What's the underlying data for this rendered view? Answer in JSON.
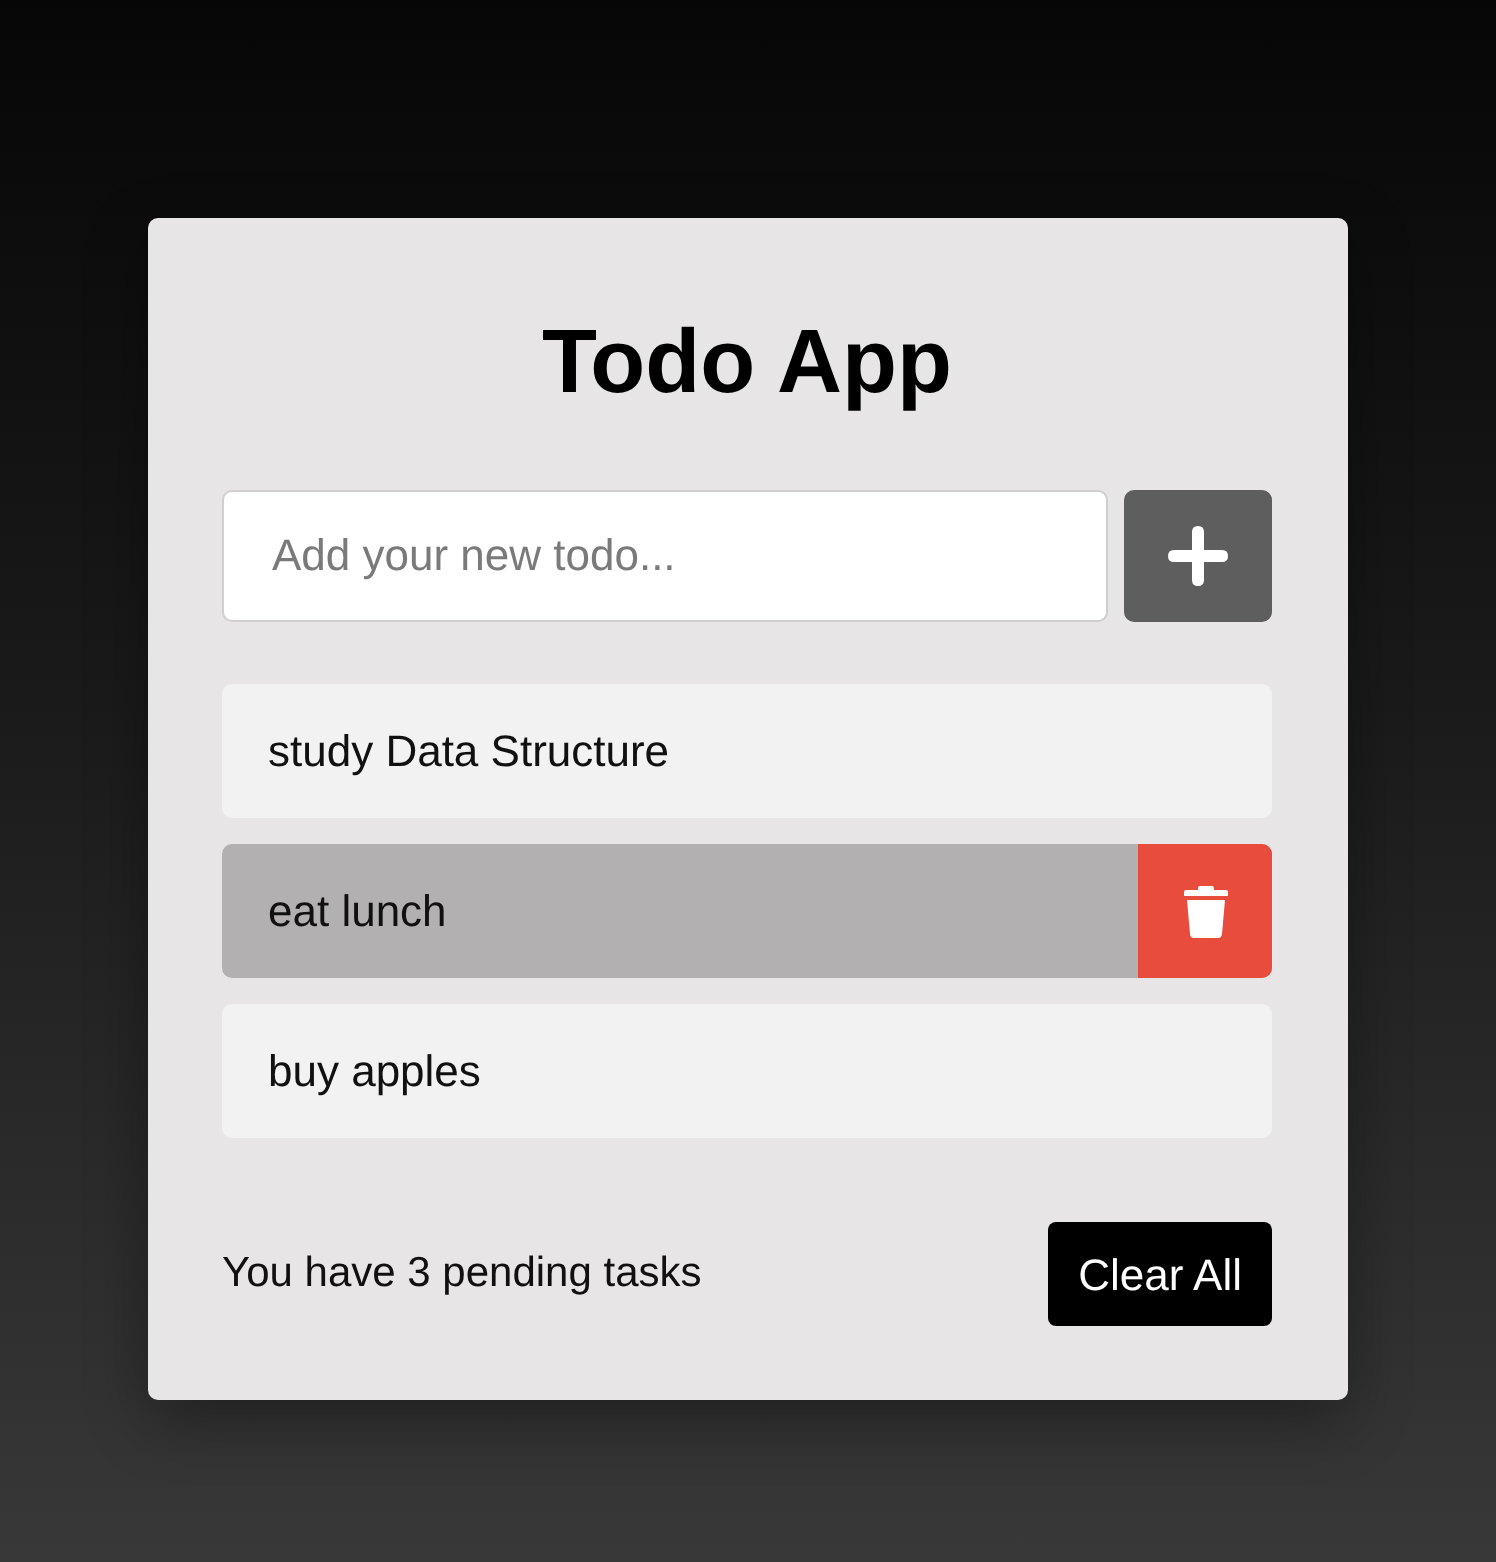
{
  "app": {
    "title": "Todo App"
  },
  "new_todo": {
    "placeholder": "Add your new todo..."
  },
  "todos": [
    {
      "text": "study Data Structure",
      "hovered": false
    },
    {
      "text": "eat lunch",
      "hovered": true
    },
    {
      "text": "buy apples",
      "hovered": false
    }
  ],
  "footer": {
    "pending_text": "You have 3 pending tasks",
    "clear_button": "Clear All"
  }
}
